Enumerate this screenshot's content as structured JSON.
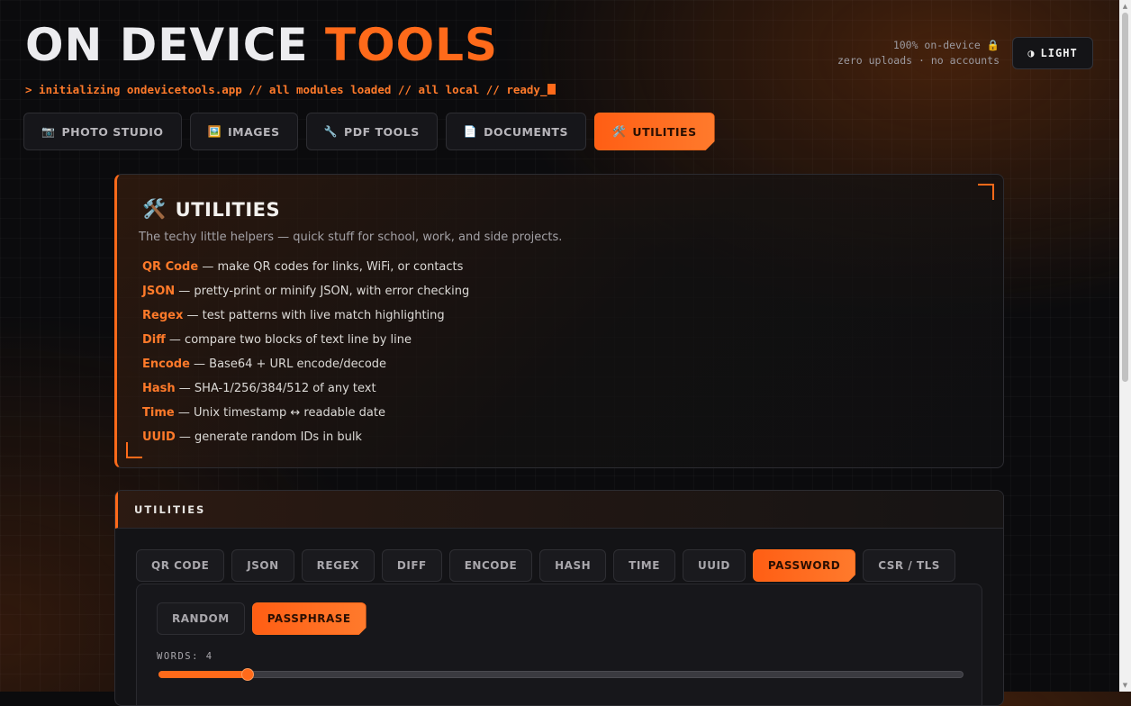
{
  "header": {
    "logo_main": "ON DEVICE",
    "logo_accent": "TOOLS",
    "boot_line": "> initializing ondevicetools.app // all modules loaded // all local // ready_",
    "status_line1": "100% on-device 🔒",
    "status_line2": "zero uploads · no accounts",
    "theme_toggle": {
      "icon": "half-circle-icon",
      "glyph": "◑",
      "label": "LIGHT"
    }
  },
  "main_tabs": [
    {
      "label": "PHOTO STUDIO",
      "icon": "camera-icon",
      "glyph": "📷",
      "active": false
    },
    {
      "label": "IMAGES",
      "icon": "picture-icon",
      "glyph": "🖼️",
      "active": false
    },
    {
      "label": "PDF TOOLS",
      "icon": "wrench-icon",
      "glyph": "🔧",
      "active": false
    },
    {
      "label": "DOCUMENTS",
      "icon": "document-icon",
      "glyph": "📄",
      "active": false
    },
    {
      "label": "UTILITIES",
      "icon": "tools-icon",
      "glyph": "🛠️",
      "active": true
    }
  ],
  "intro": {
    "title_icon": "🛠️",
    "title": "UTILITIES",
    "subtitle": "The techy little helpers — quick stuff for school, work, and side projects.",
    "items": [
      {
        "name": "QR Code",
        "desc": " — make QR codes for links, WiFi, or contacts"
      },
      {
        "name": "JSON",
        "desc": " — pretty-print or minify JSON, with error checking"
      },
      {
        "name": "Regex",
        "desc": " — test patterns with live match highlighting"
      },
      {
        "name": "Diff",
        "desc": " — compare two blocks of text line by line"
      },
      {
        "name": "Encode",
        "desc": " — Base64 + URL encode/decode"
      },
      {
        "name": "Hash",
        "desc": " — SHA-1/256/384/512 of any text"
      },
      {
        "name": "Time",
        "desc": " — Unix timestamp ↔ readable date"
      },
      {
        "name": "UUID",
        "desc": " — generate random IDs in bulk"
      }
    ]
  },
  "panel": {
    "title": "UTILITIES",
    "tool_tabs": [
      {
        "label": "QR CODE",
        "active": false
      },
      {
        "label": "JSON",
        "active": false
      },
      {
        "label": "REGEX",
        "active": false
      },
      {
        "label": "DIFF",
        "active": false
      },
      {
        "label": "ENCODE",
        "active": false
      },
      {
        "label": "HASH",
        "active": false
      },
      {
        "label": "TIME",
        "active": false
      },
      {
        "label": "UUID",
        "active": false
      },
      {
        "label": "PASSWORD",
        "active": true
      },
      {
        "label": "CSR / TLS",
        "active": false
      }
    ],
    "mode_tabs": [
      {
        "label": "RANDOM",
        "active": false
      },
      {
        "label": "PASSPHRASE",
        "active": true
      }
    ],
    "words_label": "WORDS: 4",
    "words_slider": {
      "value": 4,
      "min": 3,
      "max": 12
    }
  },
  "colors": {
    "accent": "#ff6a1a",
    "background": "#0b0b0d",
    "panel": "#131316"
  }
}
